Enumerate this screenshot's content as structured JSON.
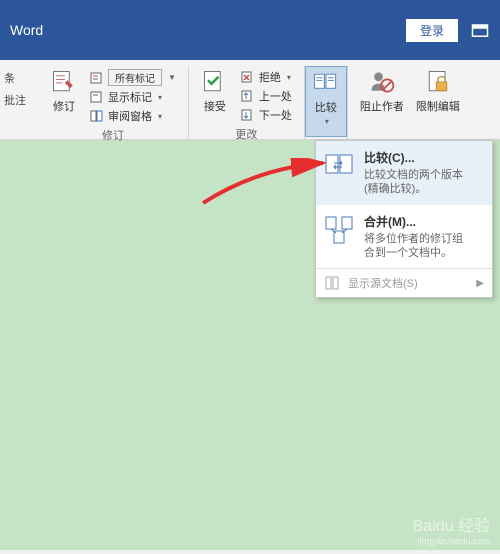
{
  "titlebar": {
    "title": "Word",
    "login_label": "登录"
  },
  "ribbon": {
    "left_edge": {
      "line1": "条",
      "line2": "批注"
    },
    "revisions": {
      "main_label": "修订",
      "all_markup": "所有标记",
      "show_markup": "显示标记",
      "review_pane": "审阅窗格",
      "group_label": "修订"
    },
    "changes": {
      "accept_label": "接受",
      "reject": "拒绝",
      "previous": "上一处",
      "next": "下一处",
      "group_label": "更改"
    },
    "compare": {
      "label": "比较"
    },
    "protect": {
      "block_authors": "阻止作者",
      "restrict_edit": "限制编辑"
    }
  },
  "dropdown": {
    "compare": {
      "title": "比较(C)...",
      "desc1": "比较文档的两个版本",
      "desc2": "(精确比较)。"
    },
    "merge": {
      "title": "合并(M)...",
      "desc1": "将多位作者的修订组",
      "desc2": "合到一个文档中。"
    },
    "show_source": "显示源文档(S)"
  },
  "watermark": {
    "main": "Baidu 经验",
    "sub": "jingyan.baidu.com"
  }
}
